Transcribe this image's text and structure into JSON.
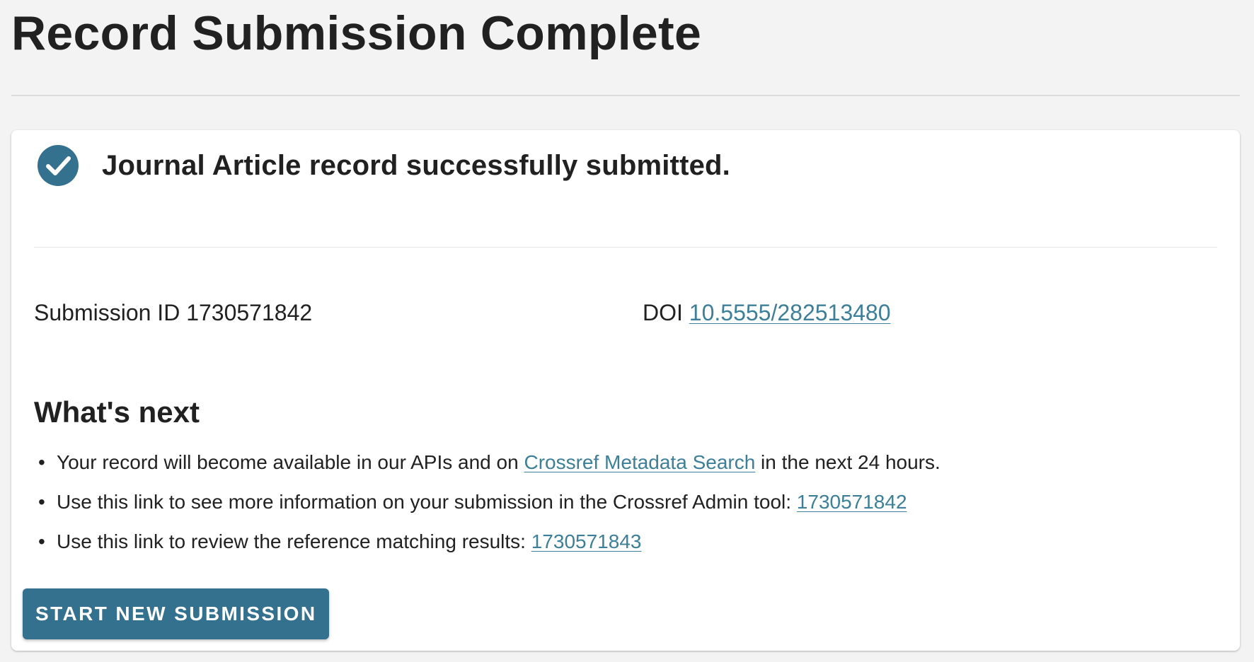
{
  "page": {
    "title": "Record Submission Complete"
  },
  "status": {
    "icon": "check-circle-icon",
    "message": "Journal Article record successfully submitted."
  },
  "submission": {
    "id_label": "Submission ID",
    "id_value": "1730571842",
    "doi_label": "DOI",
    "doi_value": "10.5555/282513480"
  },
  "whats_next": {
    "heading": "What's next",
    "items": [
      {
        "before": "Your record will become available in our APIs and on ",
        "link": "Crossref Metadata Search",
        "after": " in the next 24 hours."
      },
      {
        "before": "Use this link to see more information on your submission in the Crossref Admin tool: ",
        "link": "1730571842",
        "after": ""
      },
      {
        "before": "Use this link to review the reference matching results: ",
        "link": "1730571843",
        "after": ""
      }
    ]
  },
  "actions": {
    "start_new_label": "START NEW SUBMISSION"
  },
  "colors": {
    "accent": "#34718f",
    "link": "#3c7f99",
    "background": "#f3f3f3"
  }
}
